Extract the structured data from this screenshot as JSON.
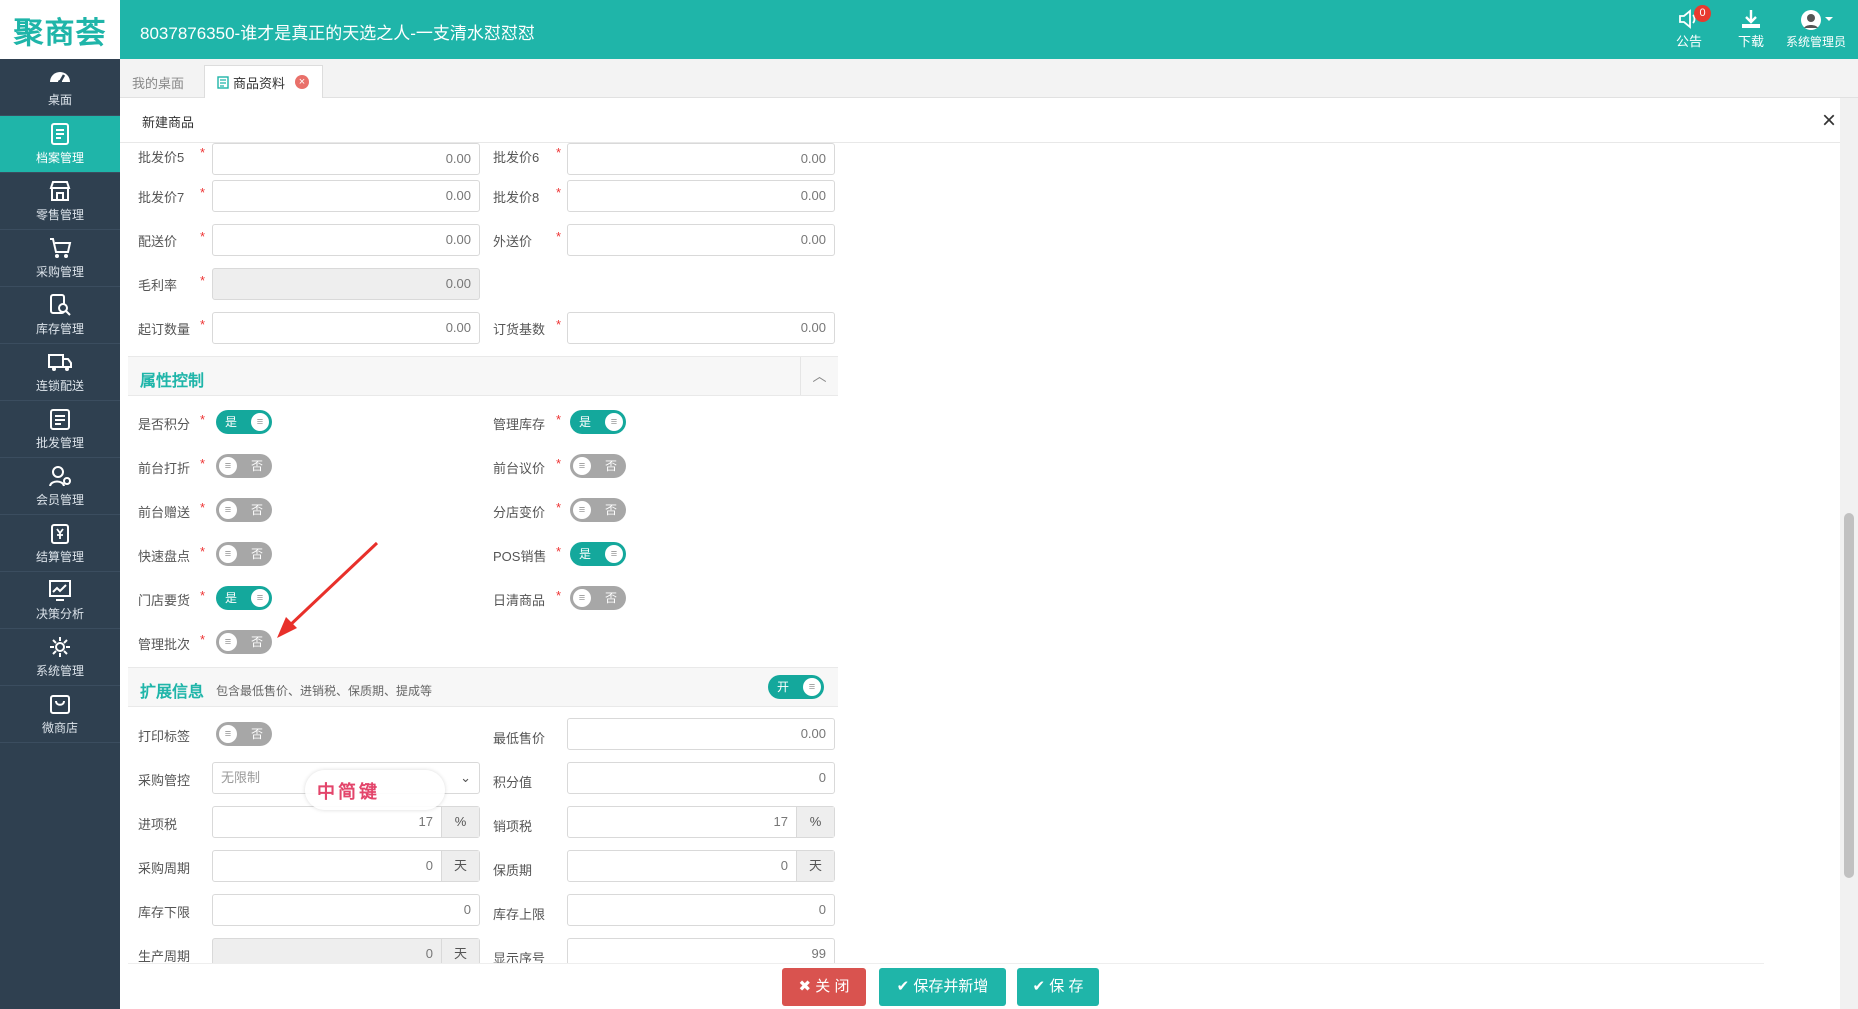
{
  "app": {
    "logo": "聚商荟",
    "title": "8037876350-谁才是真正的天选之人-一支清水怼怼怼"
  },
  "header_actions": {
    "notice_label": "公告",
    "notice_count": "0",
    "download_label": "下载",
    "user_label": "系统管理员"
  },
  "sidebar": {
    "items": [
      {
        "label": "桌面",
        "icon": "dashboard-icon"
      },
      {
        "label": "档案管理",
        "icon": "archive-icon",
        "active": true
      },
      {
        "label": "零售管理",
        "icon": "store-icon"
      },
      {
        "label": "采购管理",
        "icon": "cart-icon"
      },
      {
        "label": "库存管理",
        "icon": "inventory-icon"
      },
      {
        "label": "连锁配送",
        "icon": "truck-icon"
      },
      {
        "label": "批发管理",
        "icon": "wholesale-icon"
      },
      {
        "label": "会员管理",
        "icon": "member-icon"
      },
      {
        "label": "结算管理",
        "icon": "settlement-icon"
      },
      {
        "label": "决策分析",
        "icon": "chart-icon"
      },
      {
        "label": "系统管理",
        "icon": "gear-icon"
      },
      {
        "label": "微商店",
        "icon": "bag-icon"
      }
    ]
  },
  "tabs": {
    "desktop": "我的桌面",
    "product": "商品资料"
  },
  "dialog": {
    "title": "新建商品",
    "close": "×"
  },
  "prices": {
    "wholesale5": {
      "label": "批发价5",
      "value": "0.00"
    },
    "wholesale6": {
      "label": "批发价6",
      "value": "0.00"
    },
    "wholesale7": {
      "label": "批发价7",
      "value": "0.00"
    },
    "wholesale8": {
      "label": "批发价8",
      "value": "0.00"
    },
    "delivery": {
      "label": "配送价",
      "value": "0.00"
    },
    "external": {
      "label": "外送价",
      "value": "0.00"
    },
    "margin": {
      "label": "毛利率",
      "value": "0.00"
    },
    "min_order": {
      "label": "起订数量",
      "value": "0.00"
    },
    "order_base": {
      "label": "订货基数",
      "value": "0.00"
    }
  },
  "attributes": {
    "section_title": "属性控制",
    "toggles": [
      {
        "label": "是否积分",
        "state": "是",
        "on": true
      },
      {
        "label": "管理库存",
        "state": "是",
        "on": true
      },
      {
        "label": "前台打折",
        "state": "否",
        "on": false
      },
      {
        "label": "前台议价",
        "state": "否",
        "on": false
      },
      {
        "label": "前台赠送",
        "state": "否",
        "on": false
      },
      {
        "label": "分店变价",
        "state": "否",
        "on": false
      },
      {
        "label": "快速盘点",
        "state": "否",
        "on": false
      },
      {
        "label": "POS销售",
        "state": "是",
        "on": true
      },
      {
        "label": "门店要货",
        "state": "是",
        "on": true
      },
      {
        "label": "日清商品",
        "state": "否",
        "on": false
      },
      {
        "label": "管理批次",
        "state": "否",
        "on": false
      }
    ]
  },
  "extended": {
    "section_title": "扩展信息",
    "section_subtitle": "包含最低售价、进销税、保质期、提成等",
    "switch_state": "开",
    "print_label": {
      "label": "打印标签",
      "state": "否"
    },
    "min_price": {
      "label": "最低售价",
      "value": "0.00"
    },
    "purchase_control": {
      "label": "采购管控",
      "value": "无限制"
    },
    "points": {
      "label": "积分值",
      "value": "0"
    },
    "input_tax": {
      "label": "进项税",
      "value": "17",
      "unit": "%"
    },
    "output_tax": {
      "label": "销项税",
      "value": "17",
      "unit": "%"
    },
    "purchase_cycle": {
      "label": "采购周期",
      "value": "0",
      "unit": "天"
    },
    "shelf_life": {
      "label": "保质期",
      "value": "0",
      "unit": "天"
    },
    "stock_min": {
      "label": "库存下限",
      "value": "0"
    },
    "stock_max": {
      "label": "库存上限",
      "value": "0"
    },
    "production_cycle": {
      "label": "生产周期",
      "value": "0",
      "unit": "天"
    },
    "display_order": {
      "label": "显示序号",
      "value": "99"
    }
  },
  "buttons": {
    "close": "关 闭",
    "save_add": "保存并新增",
    "save": "保 存"
  },
  "watermark": "中简键"
}
